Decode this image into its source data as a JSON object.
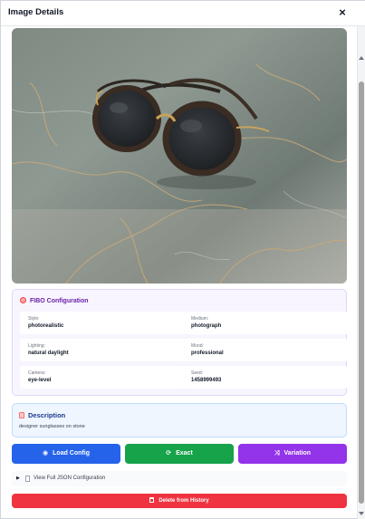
{
  "window": {
    "title": "Image Details",
    "close_glyph": "×"
  },
  "image": {
    "alt": "designer sunglasses on stone"
  },
  "fibo": {
    "title": "FIBO Configuration",
    "fields": [
      {
        "key": "Style:",
        "value": "photorealistic"
      },
      {
        "key": "Medium:",
        "value": "photograph"
      },
      {
        "key": "Lighting:",
        "value": "natural daylight"
      },
      {
        "key": "Mood:",
        "value": "professional"
      },
      {
        "key": "Camera:",
        "value": "eye-level"
      },
      {
        "key": "Seed:",
        "value": "1458999493"
      }
    ]
  },
  "description": {
    "title": "Description",
    "text": "designer sunglasses on stone"
  },
  "actions": {
    "load_config": "Load Config",
    "exact": "Exact",
    "variation": "Variation",
    "view_json": "View Full JSON Configuration",
    "delete": "Delete from History"
  },
  "colors": {
    "load": "#2563eb",
    "exact": "#16a34a",
    "variation": "#9333ea",
    "delete": "#ef3340",
    "fibo_title": "#6b21a8",
    "desc_title": "#1e3a8a"
  },
  "icons": {
    "close": "close-icon",
    "fibo": "palette-icon",
    "description": "note-icon",
    "load": "eye-icon",
    "exact": "refresh-icon",
    "variation": "shuffle-icon",
    "json": "document-icon",
    "delete": "trash-icon"
  }
}
